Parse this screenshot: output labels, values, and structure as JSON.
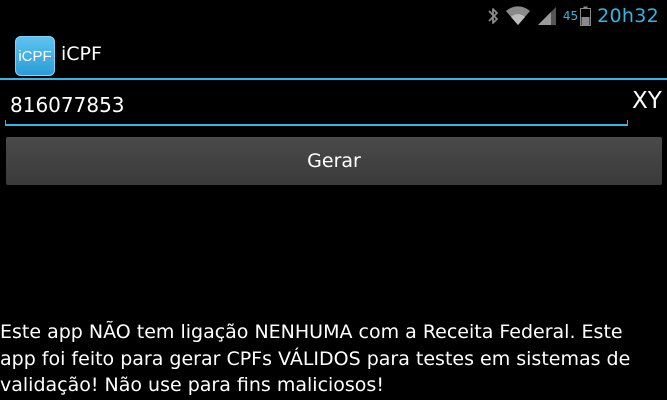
{
  "status_bar": {
    "battery_level": "45",
    "clock": "20h32",
    "icons": [
      "bluetooth-icon",
      "wifi-icon",
      "signal-icon",
      "battery-icon"
    ],
    "accent_color": "#33b5e5"
  },
  "title_bar": {
    "app_icon_text": "iCPF",
    "app_title": "iCPF"
  },
  "input": {
    "value": "816077853",
    "suffix": "XY"
  },
  "button": {
    "label": "Gerar"
  },
  "disclaimer": {
    "text": "Este app NÃO tem ligação NENHUMA com a Receita Federal. Este\napp foi feito para gerar CPFs VÁLIDOS para testes em sistemas de\nvalidação! Não use para fins maliciosos!"
  }
}
